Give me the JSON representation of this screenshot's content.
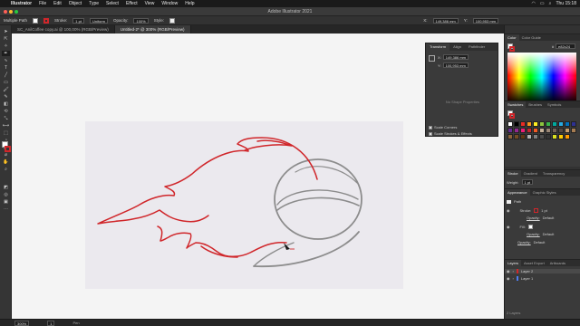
{
  "menubar": {
    "apple": "",
    "app": "Illustrator",
    "items": [
      "File",
      "Edit",
      "Object",
      "Type",
      "Select",
      "Effect",
      "View",
      "Window",
      "Help"
    ],
    "clock": "Thu 15:18"
  },
  "window": {
    "title": "Adobe Illustrator 2021"
  },
  "control_bar": {
    "selection": "Multiple Path",
    "stroke_label": "Stroke:",
    "stroke_value": "1 pt",
    "uniform": "Uniform",
    "opacity_label": "Opacity:",
    "opacity_value": "100%",
    "style_label": "Style:",
    "x_label": "X:",
    "x_value": "149,386 mm",
    "y_label": "Y:",
    "y_value": "100,953 mm"
  },
  "tabs": [
    {
      "label": "SC_AnilCoffee copy.ai @ 100,00% (RGB/Preview)",
      "active": false
    },
    {
      "label": "Untitled-2* @ 300% (RGB/Preview)",
      "active": true
    }
  ],
  "transform_panel": {
    "tabs": [
      "Transform",
      "Align",
      "Pathfinder"
    ],
    "x_label": "X:",
    "x_value": "149,386 mm",
    "y_label": "Y:",
    "y_value": "100,953 mm",
    "empty_message": "No Shape Properties",
    "scale_corners": "Scale Corners",
    "scale_strokes": "Scale Strokes & Effects"
  },
  "color_panel": {
    "tabs": [
      "Color",
      "Color Guide"
    ],
    "hex_prefix": "#",
    "hex": "e82c24"
  },
  "swatches_panel": {
    "tabs": [
      "Swatches",
      "Brushes",
      "Symbols"
    ],
    "colors": [
      "#ffffff",
      "#000000",
      "#e82c24",
      "#f7931e",
      "#fcee21",
      "#8cc63f",
      "#39b54a",
      "#00a99d",
      "#29abe2",
      "#0071bc",
      "#2e3192",
      "#662d91",
      "#93278f",
      "#ed1e79",
      "#c1272d",
      "#f15a24",
      "#c7b299",
      "#998675",
      "#736357",
      "#534741",
      "#c69c6d",
      "#a67c52",
      "#8c6239",
      "#754c24",
      "#603813",
      "#b3b3b3",
      "#808080",
      "#4d4d4d",
      "#333333",
      "#d9e021",
      "#ffcc00",
      "#ff9900"
    ]
  },
  "stroke_panel": {
    "tabs": [
      "Stroke",
      "Gradient",
      "Transparency"
    ],
    "weight_label": "Weight:",
    "weight_value": "1 pt"
  },
  "appearance_panel": {
    "tabs": [
      "Appearance",
      "Graphic Styles"
    ],
    "path_label": "Path",
    "stroke_label": "Stroke:",
    "stroke_value": "1 pt",
    "opacity_label": "Opacity:",
    "opacity_value": "Default",
    "fill_label": "Fill:",
    "fill_opacity_label": "Opacity:",
    "fill_opacity_value": "Default",
    "path_opacity_label": "Opacity:",
    "path_opacity_value": "Default"
  },
  "layers_panel": {
    "tabs": [
      "Layers",
      "Asset Export",
      "Artboards"
    ],
    "layers": [
      "Layer 2",
      "Layer 1"
    ],
    "count": "2 Layers"
  },
  "status_bar": {
    "zoom": "300%",
    "artboard": "1",
    "tool": "Pen"
  },
  "colors": {
    "accent_red": "#d0262a",
    "sketch_gray": "#8c8c8c"
  }
}
